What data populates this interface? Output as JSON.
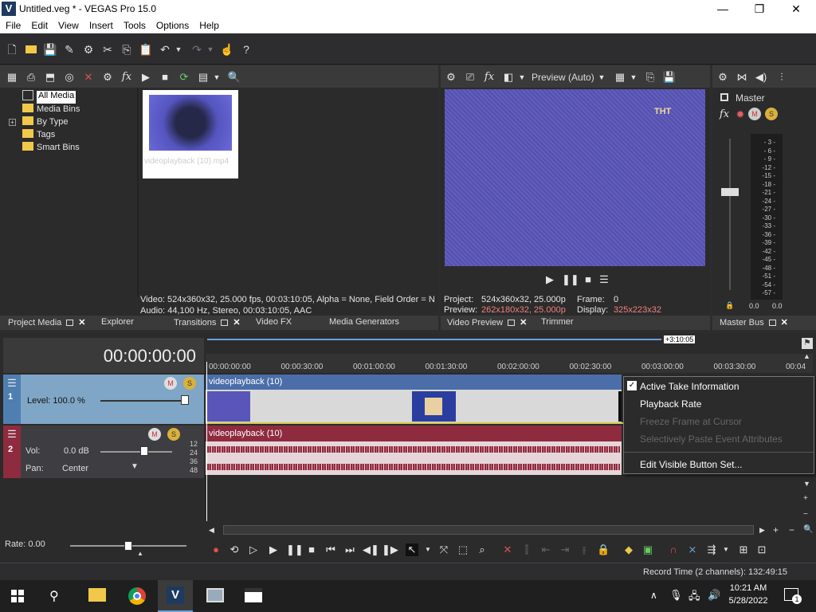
{
  "window": {
    "title": "Untitled.veg * - VEGAS Pro 15.0",
    "logo_letter": "V",
    "min": "—",
    "max": "❐",
    "close": "✕"
  },
  "menu": [
    "File",
    "Edit",
    "View",
    "Insert",
    "Tools",
    "Options",
    "Help"
  ],
  "explorer": {
    "tree": [
      "All Media",
      "Media Bins",
      "By Type",
      "Tags",
      "Smart Bins"
    ],
    "expander": "+",
    "thumb_label": "videoplayback (10).mp4",
    "info_video": "Video: 524x360x32, 25.000 fps, 00:03:10:05, Alpha = None, Field Order = N",
    "info_audio": "Audio: 44,100 Hz, Stereo, 00:03:10:05, AAC",
    "tabs": [
      "Project Media",
      "Explorer",
      "Transitions",
      "Video FX",
      "Media Generators"
    ]
  },
  "preview": {
    "mode": "Preview (Auto)",
    "watermark": "THT",
    "project_label": "Project:",
    "project_value": "524x360x32, 25.000p",
    "preview_label": "Preview:",
    "preview_value": "262x180x32, 25.000p",
    "frame_label": "Frame:",
    "frame_value": "0",
    "display_label": "Display:",
    "display_value": "325x223x32",
    "tabs": [
      "Video Preview",
      "Trimmer"
    ]
  },
  "master": {
    "label": "Master",
    "ticks": [
      "- 3 -",
      "- 6 -",
      "- 9 -",
      "-12 -",
      "-15 -",
      "-18 -",
      "-21 -",
      "-24 -",
      "-27 -",
      "-30 -",
      "-33 -",
      "-36 -",
      "-39 -",
      "-42 -",
      "-45 -",
      "-48 -",
      "-51 -",
      "-54 -",
      "-57 -"
    ],
    "left_value": "0.0",
    "right_value": "0.0",
    "tab": "Master Bus"
  },
  "timeline": {
    "timecode": "00:00:00:00",
    "end_marker": "+3:10:05",
    "ruler": [
      "00:00:00:00",
      "00:00:30:00",
      "00:01:00:00",
      "00:01:30:00",
      "00:02:00:00",
      "00:02:30:00",
      "00:03:00:00",
      "00:03:30:00",
      "00:04"
    ],
    "video_track": {
      "number": "1",
      "level": "Level: 100.0 %",
      "clip": "videoplayback (10)"
    },
    "audio_track": {
      "number": "2",
      "vol_label": "Vol:",
      "vol_value": "0.0 dB",
      "pan_label": "Pan:",
      "pan_value": "Center",
      "clip": "videoplayback (10)",
      "scale": [
        "12",
        "24",
        "36",
        "48"
      ]
    },
    "rate": "Rate: 0.00"
  },
  "context_menu": {
    "items": [
      {
        "label": "Active Take Information",
        "checked": true,
        "enabled": true
      },
      {
        "label": "Playback Rate",
        "checked": false,
        "enabled": true
      },
      {
        "label": "Freeze Frame at Cursor",
        "checked": false,
        "enabled": false
      },
      {
        "label": "Selectively Paste Event Attributes",
        "checked": false,
        "enabled": false
      },
      {
        "label": "Edit Visible Button Set...",
        "checked": false,
        "enabled": true
      }
    ]
  },
  "status": {
    "record_time": "Record Time (2 channels): 132:49:15"
  },
  "taskbar": {
    "time": "10:21 AM",
    "date": "5/28/2022",
    "notif_count": "1"
  },
  "colors": {
    "video_header": "#7fa6c6",
    "audio_header": "#3e3e42",
    "video_clip": "#4b6ea8",
    "audio_clip": "#8f2b3f",
    "context_bg": "#2b2b2b"
  }
}
